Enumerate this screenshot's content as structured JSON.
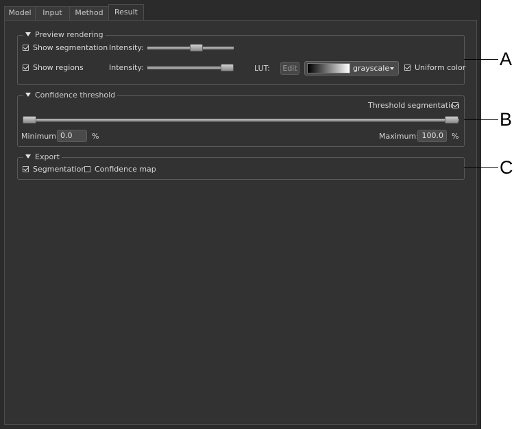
{
  "tabs": [
    "Model",
    "Input",
    "Method",
    "Result"
  ],
  "active_tab": "Result",
  "preview": {
    "title": "Preview rendering",
    "show_segmentation": {
      "label": "Show segmentation",
      "checked": true
    },
    "show_regions": {
      "label": "Show regions",
      "checked": true
    },
    "intensity_label": "Intensity:",
    "segmentation_intensity_pct": 58,
    "regions_intensity_pct": 100,
    "lut_label": "LUT:",
    "edit_label": "Edit",
    "lut_value": "grayscale",
    "uniform_color": {
      "label": "Uniform color",
      "checked": true
    }
  },
  "confidence": {
    "title": "Confidence threshold",
    "threshold_segmentation": {
      "label": "Threshold segmentation",
      "checked": true
    },
    "minimum_label": "Minimum:",
    "minimum_value": "0.0",
    "maximum_label": "Maximum:",
    "maximum_value": "100.0",
    "unit": "%"
  },
  "export": {
    "title": "Export",
    "segmentation": {
      "label": "Segmentation",
      "checked": true
    },
    "confidence_map": {
      "label": "Confidence map",
      "checked": false
    }
  },
  "callouts": [
    "A",
    "B",
    "C"
  ]
}
